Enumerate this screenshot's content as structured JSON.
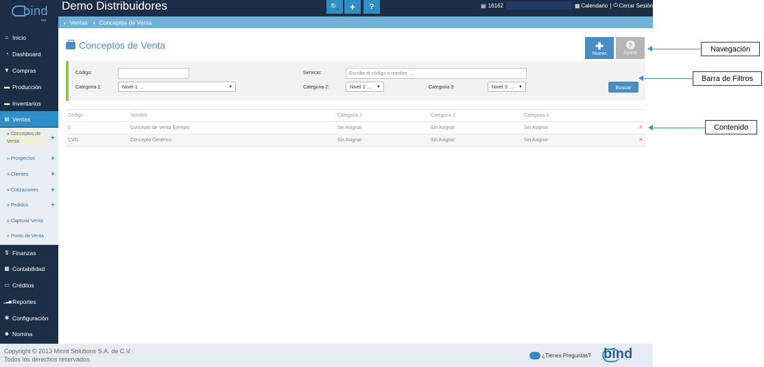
{
  "app": {
    "logo_text": "bind",
    "logo_sub": "erp",
    "title": "Demo Distribuidores"
  },
  "topbar": {
    "buttons": [
      {
        "icon": "search-icon",
        "glyph": "🔍"
      },
      {
        "icon": "plus-icon",
        "glyph": "+"
      },
      {
        "icon": "help-icon",
        "glyph": "?"
      }
    ],
    "counter": "16162",
    "calendar_label": "Calendario",
    "separator": "|",
    "logout_label": "Cerrar Sesión"
  },
  "breadcrumb": [
    "Ventas",
    "Conceptos de Venta"
  ],
  "sidebar": {
    "items": [
      {
        "label": "Inicio",
        "icon": "home-icon",
        "glyph": "⌂"
      },
      {
        "label": "Dashboard",
        "icon": "dashboard-icon",
        "glyph": "◔"
      },
      {
        "label": "Compras",
        "icon": "cart-icon",
        "glyph": "▼"
      },
      {
        "label": "Producción",
        "icon": "truck-icon",
        "glyph": "▬"
      },
      {
        "label": "Inventarios",
        "icon": "truck-icon",
        "glyph": "▬"
      },
      {
        "label": "Ventas",
        "icon": "receipt-icon",
        "glyph": "▤",
        "active": true
      }
    ],
    "sub_items": [
      {
        "label": "» Conceptos de Venta",
        "plus": true,
        "current": true
      },
      {
        "label": "» Prospectos",
        "plus": true
      },
      {
        "label": "» Clientes",
        "plus": true
      },
      {
        "label": "» Cotizaciones",
        "plus": true
      },
      {
        "label": "» Pedidos",
        "plus": true
      },
      {
        "label": "» Capturar Venta",
        "plus": false
      },
      {
        "label": "» Punto de Venta",
        "plus": false
      }
    ],
    "lower_items": [
      {
        "label": "Finanzas",
        "icon": "dollar-icon",
        "glyph": "$"
      },
      {
        "label": "Contabilidad",
        "icon": "calculator-icon",
        "glyph": "▦"
      },
      {
        "label": "Créditos",
        "icon": "credit-card-icon",
        "glyph": "▭"
      },
      {
        "label": "Reportes",
        "icon": "signal-icon",
        "glyph": "▁▃▅"
      },
      {
        "label": "Configuración",
        "icon": "cogs-icon",
        "glyph": "✱"
      },
      {
        "label": "Nomina",
        "icon": "users-icon",
        "glyph": "☻"
      }
    ]
  },
  "page": {
    "title": "Conceptos de Venta",
    "new_label": "Nuevo",
    "help_label": "Ayuda"
  },
  "filters": {
    "codigo_label": "Código:",
    "codigo_value": "",
    "servicio_label": "Servicio:",
    "servicio_placeholder": "Escribe el código o nombre .....",
    "cat1_label": "Categoria 1:",
    "cat1_value": "Nivel 1 ...",
    "cat2_label": "Categoria 2:",
    "cat2_value": "Nivel 2 ...",
    "cat3_label": "Categoria 3:",
    "cat3_value": "Nivel 3 ...",
    "search_label": "Buscar"
  },
  "table": {
    "headers": [
      "Código",
      "Nombre",
      "Categoria 1",
      "Categoria 2",
      "Categoria 3"
    ],
    "rows": [
      [
        "2",
        "Concepto de Venta Ejemplo",
        "Sin Asignar",
        "Sin Asignar",
        "Sin Asignar"
      ],
      [
        "CVG",
        "Concepto Genérico",
        "Sin Asignar",
        "Sin Asignar",
        "Sin Asignar"
      ]
    ]
  },
  "footer": {
    "copyright": "Copyright © 2013 Minnt Solutions S.A. de C.V.",
    "rights": "Todos los derechos reservados.",
    "faq": "¿Tienes Preguntas?",
    "logo_text": "bind"
  },
  "annotations": [
    "Navegación",
    "Barra de Filtros",
    "Contenido"
  ],
  "colors": {
    "sidebar_bg": "#1b2e45",
    "accent": "#2d8fc5",
    "filter_border": "#8cc63f",
    "delete": "#e06b6b"
  }
}
